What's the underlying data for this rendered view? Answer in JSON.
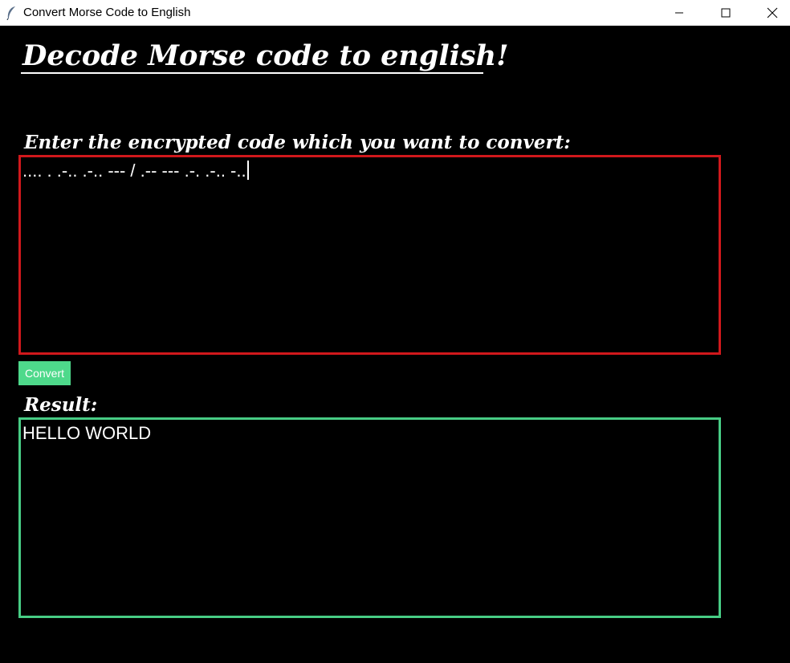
{
  "window": {
    "title": "Convert Morse Code to English",
    "icon": "feather-icon",
    "controls": [
      "minimize-icon",
      "maximize-icon",
      "close-icon"
    ]
  },
  "main": {
    "heading": "Decode Morse code to english!",
    "input_label": "Enter the encrypted code which you want to convert:",
    "input_value": ".... . .-.. .-.. --- / .-- --- .-. .-.. -..",
    "convert_label": "Convert",
    "result_label": "Result:",
    "result_value": "HELLO WORLD"
  },
  "colors": {
    "background": "#000000",
    "input_border": "#d0181c",
    "result_border": "#47cc84",
    "button_bg": "#4ed98b"
  }
}
